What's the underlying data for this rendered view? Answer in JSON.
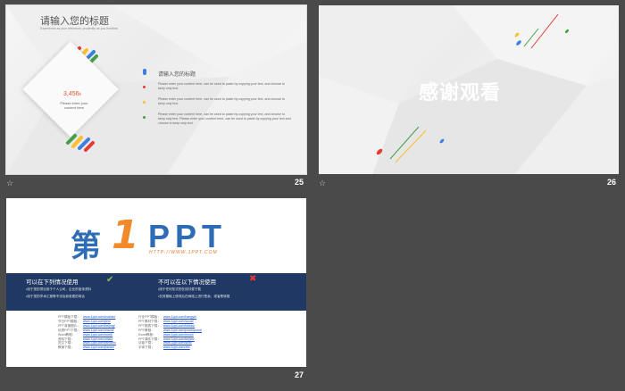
{
  "slides": [
    {
      "number": "25",
      "title": "请输入您的标题",
      "subtitle": "Experience as your reference, prudently as you frontline",
      "stat_value": "3,456",
      "stat_unit": "k",
      "stat_caption": "Please enter your content here",
      "heading": "请输入您的标题",
      "paragraph_1": "Please enter your content here, can be used to paste by copying your text, and choose to keep only text.",
      "paragraph_2": "Please enter your content here, can be used to paste by copying your text, and choose to keep only text.",
      "paragraph_3": "Please enter your content here, can be used to paste by copying your text, and choose to keep only text. Please enter your content here, can be used to paste by copying your text and choose to keep only text."
    },
    {
      "number": "26",
      "thanks_text": "感谢观看"
    },
    {
      "number": "27",
      "logo_prefix": "第",
      "logo_one": "1",
      "logo_ppt": "PPT",
      "logo_url": "HTTP://WWW.1PPT.COM",
      "allowed_heading": "可以在下列情况使用",
      "allowed_items": [
        "•用于您的项目用于个人公司，企业的宣传资料",
        "•用于您的学术汇报等不涉及到收费的场合"
      ],
      "forbidden_heading": "不可以在以下情况使用",
      "forbidden_items": [
        "•用于任何形式的在线付费下载",
        "•在其基础上修改后在网络上进行售卖，或者是转载"
      ],
      "links_left": [
        {
          "label": "PPT模板下载：",
          "url": "www.1ppt.com/moban/"
        },
        {
          "label": "节日PPT模板：",
          "url": "www.1ppt.com/jieri/"
        },
        {
          "label": "PPT背景图片：",
          "url": "www.1ppt.com/beijing/"
        },
        {
          "label": "优秀PPT下载：",
          "url": "www.1ppt.com/xiazai/"
        },
        {
          "label": "Word教程：",
          "url": "www.1ppt.com/word/"
        },
        {
          "label": "资料下载：",
          "url": "www.1ppt.com/ziliao/"
        },
        {
          "label": "范文下载：",
          "url": "www.1ppt.com/fanwen/"
        },
        {
          "label": "教案下载：",
          "url": "www.1ppt.com/jiaoan/"
        }
      ],
      "links_right": [
        {
          "label": "行业PPT模板：",
          "url": "www.1ppt.com/hangye/"
        },
        {
          "label": "PPT素材下载：",
          "url": "www.1ppt.com/sucai/"
        },
        {
          "label": "PPT图表下载：",
          "url": "www.1ppt.com/tubiao/"
        },
        {
          "label": "PPT教程：",
          "url": "www.1ppt.com/powerpoint/"
        },
        {
          "label": "Excel教程：",
          "url": "www.1ppt.com/excel/"
        },
        {
          "label": "PPT课件下载：",
          "url": "www.1ppt.com/kejian/"
        },
        {
          "label": "试卷下载：",
          "url": "www.1ppt.com/shiti/"
        },
        {
          "label": "字体下载：",
          "url": "www.1ppt.com/ziti/"
        }
      ]
    }
  ],
  "colors": {
    "workspace": "#4a4a4a",
    "band": "#1f3864",
    "blue": "#3b7fe0",
    "red": "#e53935",
    "yellow": "#fbc02d",
    "green": "#43a047",
    "orange": "#f08a2a"
  }
}
